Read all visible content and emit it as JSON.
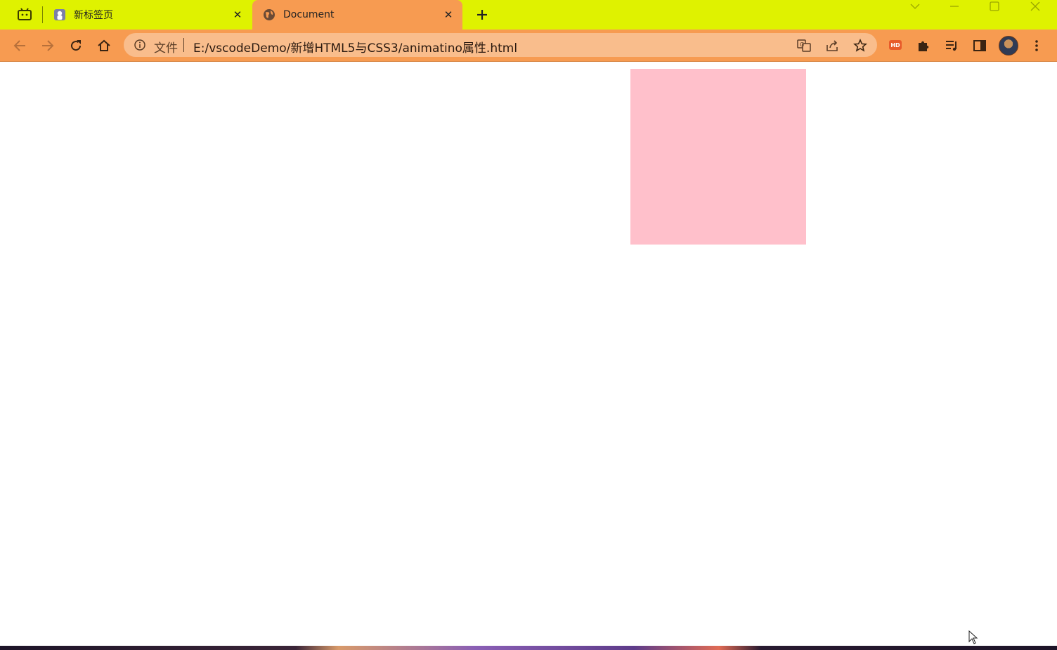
{
  "browser": {
    "tabs": [
      {
        "title": "新标签页",
        "favicon": "new-tab-favicon",
        "active": false
      },
      {
        "title": "Document",
        "favicon": "globe-icon",
        "active": true
      }
    ],
    "new_tab_symbol": "+",
    "close_symbol": "✕",
    "address_bar": {
      "scheme_label": "文件",
      "url": "E:/vscodeDemo/新增HTML5与CSS3/animatino属性.html"
    },
    "extension_badge": "HD"
  },
  "page": {
    "box_color": "#ffc0cb"
  },
  "colors": {
    "tabstrip": "#dff200",
    "toolbar": "#f79b51",
    "omnibox": "#f9bd8c"
  }
}
